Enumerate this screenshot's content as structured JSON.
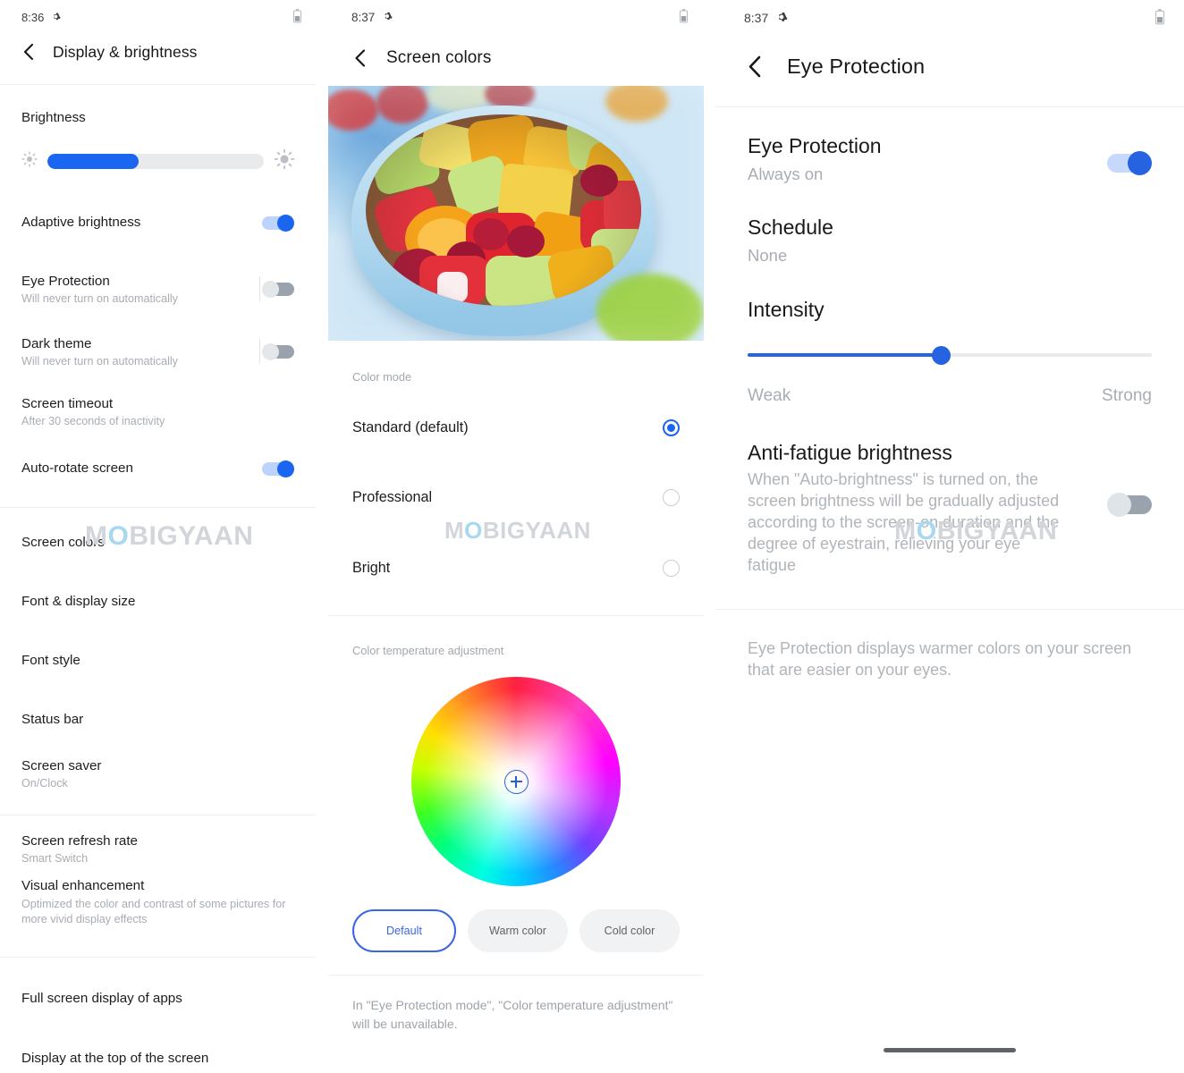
{
  "panels": [
    {
      "id": "display-brightness",
      "status": {
        "time": "8:36",
        "gear_icon": "gear-icon",
        "battery_icon": "battery-icon"
      },
      "header": {
        "back_icon": "back-chevron-icon",
        "title": "Display & brightness"
      },
      "brightness": {
        "label": "Brightness",
        "low_icon": "brightness-low-icon",
        "high_icon": "brightness-high-icon",
        "value_percent": 42
      },
      "items": [
        {
          "title": "Adaptive brightness",
          "sub": "",
          "control": "toggle",
          "state": "on"
        },
        {
          "title": "Eye Protection",
          "sub": "Will never turn on automatically",
          "control": "toggle",
          "state": "off"
        },
        {
          "title": "Dark theme",
          "sub": "Will never turn on automatically",
          "control": "toggle",
          "state": "off"
        },
        {
          "title": "Screen timeout",
          "sub": "After 30 seconds of inactivity",
          "control": "none",
          "state": ""
        },
        {
          "title": "Auto-rotate screen",
          "sub": "",
          "control": "toggle",
          "state": "on"
        },
        {
          "title": "Screen colors",
          "sub": "",
          "control": "none",
          "state": ""
        },
        {
          "title": "Font & display size",
          "sub": "",
          "control": "none",
          "state": ""
        },
        {
          "title": "Font style",
          "sub": "",
          "control": "none",
          "state": ""
        },
        {
          "title": "Status bar",
          "sub": "",
          "control": "none",
          "state": ""
        },
        {
          "title": "Screen saver",
          "sub": "On/Clock",
          "control": "none",
          "state": ""
        },
        {
          "title": "Screen refresh rate",
          "sub": "Smart Switch",
          "control": "none",
          "state": ""
        },
        {
          "title": "Visual enhancement",
          "sub": "Optimized the color and contrast of some pictures for more vivid display effects",
          "control": "none",
          "state": ""
        },
        {
          "title": "Full screen display of apps",
          "sub": "",
          "control": "none",
          "state": ""
        },
        {
          "title": "Display at the top of the screen",
          "sub": "",
          "control": "none",
          "state": ""
        }
      ],
      "watermark": "MOBIGYAAN"
    },
    {
      "id": "screen-colors",
      "status": {
        "time": "8:37",
        "gear_icon": "gear-icon",
        "battery_icon": "battery-icon"
      },
      "header": {
        "back_icon": "back-chevron-icon",
        "title": "Screen colors"
      },
      "preview": {
        "alt": "fruit-salad-preview-photo"
      },
      "color_mode": {
        "label": "Color mode",
        "options": [
          {
            "label": "Standard (default)",
            "selected": true
          },
          {
            "label": "Professional",
            "selected": false
          },
          {
            "label": "Bright",
            "selected": false
          }
        ]
      },
      "temperature": {
        "label": "Color temperature adjustment",
        "handle_icon": "color-picker-crosshair-icon",
        "chips": [
          {
            "label": "Default",
            "active": true
          },
          {
            "label": "Warm color",
            "active": false
          },
          {
            "label": "Cold color",
            "active": false
          }
        ]
      },
      "footnote": "In \"Eye Protection mode\", \"Color temperature adjustment\" will be unavailable.",
      "watermark": "MOBIGYAAN"
    },
    {
      "id": "eye-protection",
      "status": {
        "time": "8:37",
        "gear_icon": "gear-icon",
        "battery_icon": "battery-icon"
      },
      "header": {
        "back_icon": "back-chevron-icon",
        "title": "Eye Protection"
      },
      "items": [
        {
          "title": "Eye Protection",
          "sub": "Always on",
          "control": "toggle",
          "state": "on"
        },
        {
          "title": "Schedule",
          "sub": "None",
          "control": "none",
          "state": ""
        }
      ],
      "intensity": {
        "label": "Intensity",
        "value_percent": 48,
        "min_label": "Weak",
        "max_label": "Strong"
      },
      "anti_fatigue": {
        "title": "Anti-fatigue brightness",
        "desc": "When \"Auto-brightness\" is turned on, the screen brightness will be gradually adjusted according to the screen-on duration and the degree of eyestrain, relieving your eye fatigue",
        "control": "toggle",
        "state": "off"
      },
      "footnote": "Eye Protection displays warmer colors on your screen that are easier on your eyes.",
      "home_indicator": "home-indicator-bar",
      "watermark": "MOBIGYAAN"
    }
  ],
  "colors": {
    "accent_blue": "#1a66f0",
    "accent_blue_dark": "#2563e0",
    "toggle_off_gray": "#9aa3ad",
    "text_primary": "#1b1d1f",
    "text_secondary": "#a8adb3",
    "divider": "#eceef0"
  }
}
